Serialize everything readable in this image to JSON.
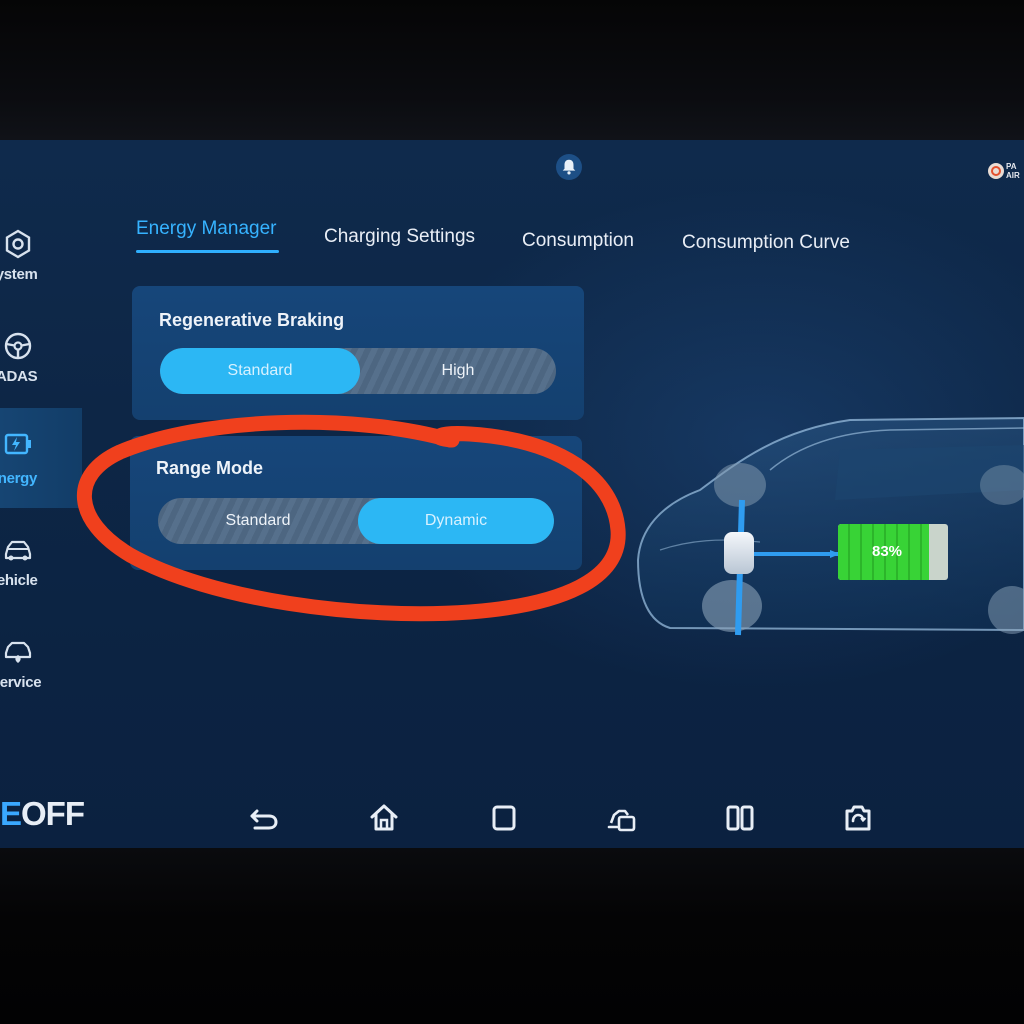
{
  "sidebar": {
    "items": [
      {
        "label": "System",
        "icon": "gear-hexagon-icon",
        "active": false
      },
      {
        "label": "ADAS",
        "icon": "steering-wheel-icon",
        "active": false
      },
      {
        "label": "Energy",
        "icon": "battery-bolt-icon",
        "active": true
      },
      {
        "label": "Vehicle",
        "icon": "car-icon",
        "active": false
      },
      {
        "label": "Service",
        "icon": "car-service-icon",
        "active": false
      }
    ]
  },
  "tabs": [
    {
      "label": "Energy Manager",
      "active": true
    },
    {
      "label": "Charging Settings",
      "active": false
    },
    {
      "label": "Consumption",
      "active": false
    },
    {
      "label": "Consumption Curve",
      "active": false
    }
  ],
  "regenerative_braking": {
    "title": "Regenerative Braking",
    "options": [
      "Standard",
      "High"
    ],
    "selected": "Standard"
  },
  "range_mode": {
    "title": "Range Mode",
    "options": [
      "Standard",
      "Dynamic"
    ],
    "selected": "Dynamic"
  },
  "battery": {
    "percent_label": "83%",
    "level": 0.83,
    "fill_color": "#38d336"
  },
  "status": {
    "airbag_text_line1": "PA",
    "airbag_text_line2": "AIR",
    "airbag_icon": "airbag-off-icon",
    "notification_icon": "notification-icon"
  },
  "bottom_bar": {
    "eoff_prefix": "E",
    "eoff_text": "OFF",
    "nav_icons": [
      "back-icon",
      "home-icon",
      "recent-apps-icon",
      "car-settings-icon",
      "split-screen-icon",
      "screenshot-icon"
    ]
  },
  "colors": {
    "accent": "#36b3ff",
    "selected_segment": "#2cb7f4",
    "annotation": "#f0401d"
  }
}
